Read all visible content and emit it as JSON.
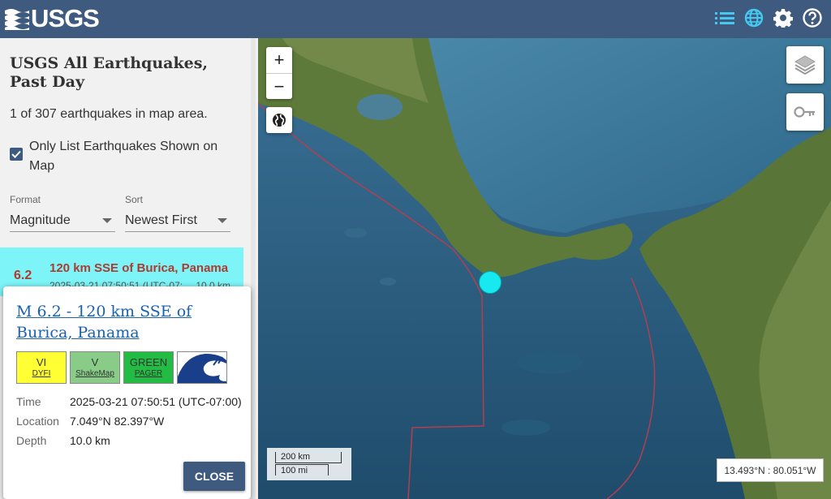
{
  "header": {
    "logo_text": "USGS",
    "icons": [
      "list-icon",
      "globe-icon",
      "gear-icon",
      "help-icon"
    ],
    "color": "#3e5a7e"
  },
  "sidebar": {
    "title": "USGS All Earthquakes, Past Day",
    "count_text": "1 of 307 earthquakes in map area.",
    "only_list_label": "Only List Earthquakes Shown on Map",
    "only_list_checked": true,
    "format": {
      "caption": "Format",
      "value": "Magnitude"
    },
    "sort": {
      "caption": "Sort",
      "value": "Newest First"
    },
    "selected_event": {
      "mag": "6.2",
      "place": "120 km SSE of Burica, Panama",
      "time": "2025-03-21 07:50:51 (UTC-07:",
      "depth": "10.0 km",
      "highlight_color": "#7cf4f8"
    }
  },
  "popup": {
    "title": "M 6.2 - 120 km SSE of Burica, Panama",
    "badges": {
      "dyfi": {
        "value": "VI",
        "label": "DYFI"
      },
      "shakemap": {
        "value": "V",
        "label": "ShakeMap"
      },
      "pager": {
        "value": "GREEN",
        "label": "PAGER"
      },
      "tsunami": {
        "icon": "tsunami-icon"
      }
    },
    "details": [
      {
        "label": "Time",
        "value": "2025-03-21 07:50:51 (UTC-07:00)"
      },
      {
        "label": "Location",
        "value": "7.049°N 82.397°W"
      },
      {
        "label": "Depth",
        "value": "10.0 km"
      }
    ],
    "close_label": "CLOSE"
  },
  "map": {
    "zoom_in": "+",
    "zoom_out": "−",
    "scale_km": "200 km",
    "scale_mi": "100 mi",
    "coords": "13.493°N : 80.051°W",
    "marker_color": "#18e8f0"
  }
}
